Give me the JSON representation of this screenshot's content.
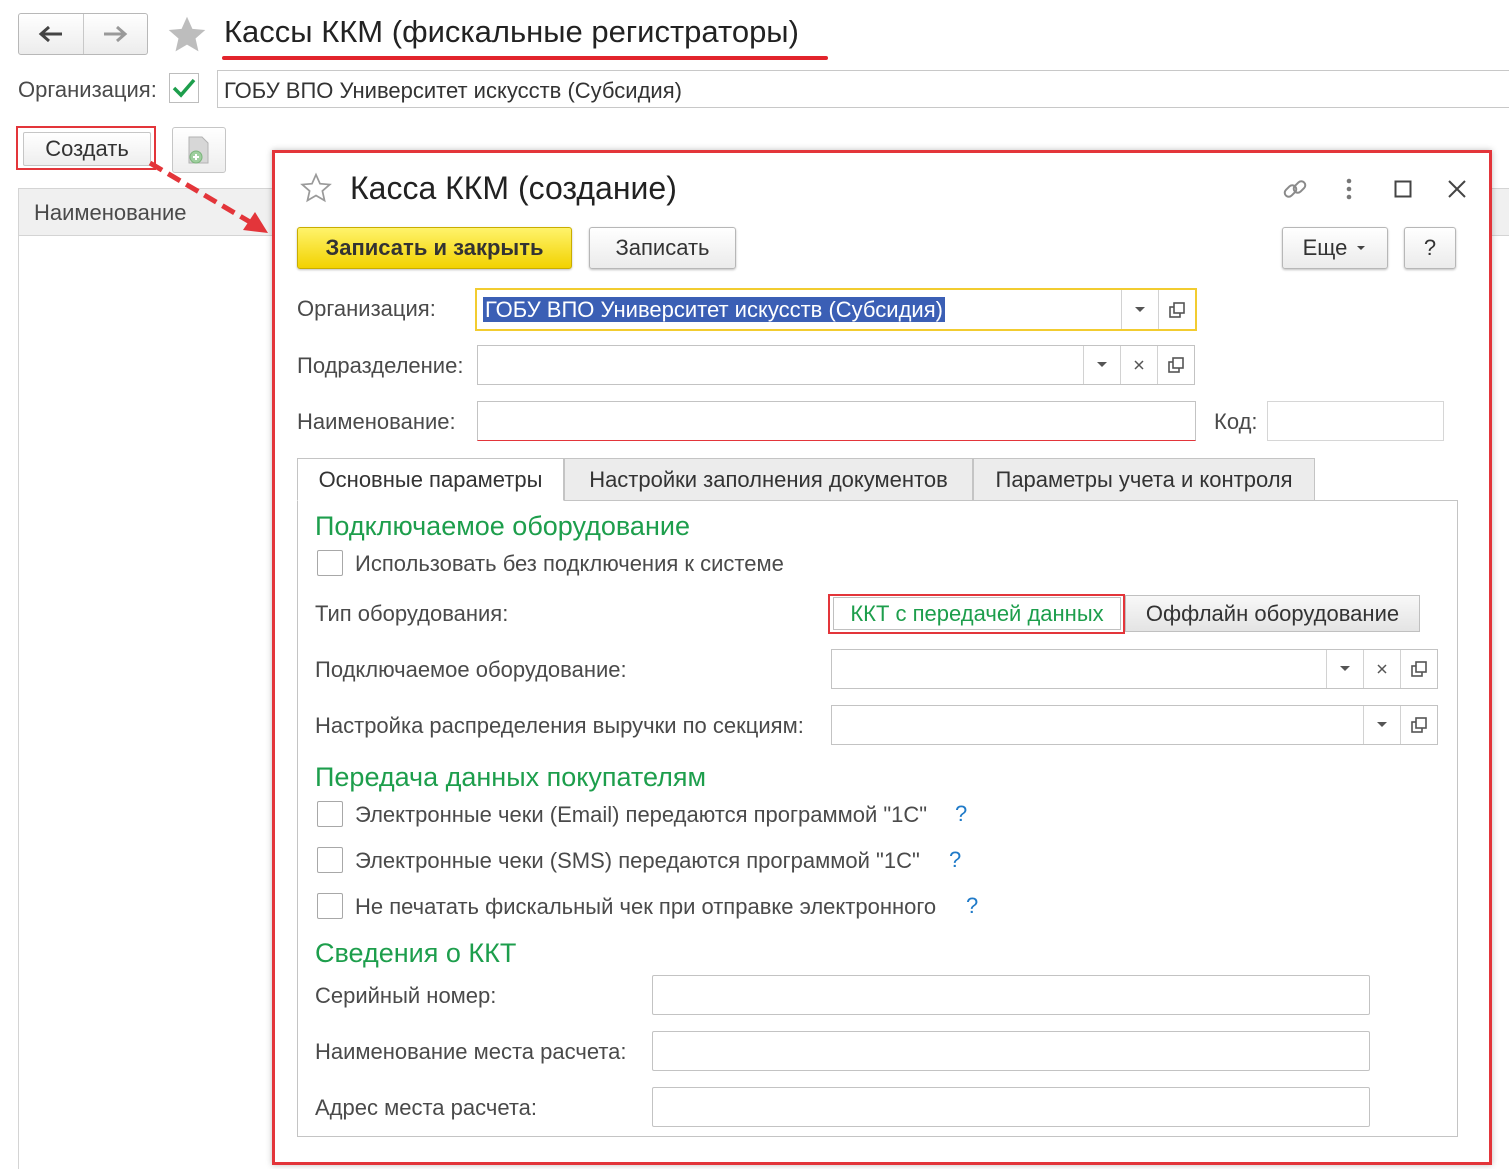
{
  "list_window": {
    "title": "Кассы ККМ (фискальные регистраторы)",
    "org_label": "Организация:",
    "org_checked": true,
    "org_value": "ГОБУ ВПО Университет искусств (Субсидия)",
    "create_button": "Создать",
    "column_name": "Наименование"
  },
  "dialog": {
    "title": "Касса ККМ (создание)",
    "buttons": {
      "save_close": "Записать и закрыть",
      "save": "Записать",
      "more": "Еще",
      "help": "?"
    },
    "fields": {
      "org_label": "Организация:",
      "org_value": "ГОБУ ВПО Университет искусств (Субсидия)",
      "subdivision_label": "Подразделение:",
      "subdivision_value": "",
      "name_label": "Наименование:",
      "name_value": "",
      "code_label": "Код:",
      "code_value": ""
    },
    "tabs": [
      "Основные параметры",
      "Настройки заполнения документов",
      "Параметры учета и контроля"
    ],
    "active_tab": "Основные параметры",
    "equipment": {
      "heading": "Подключаемое оборудование",
      "use_without_connection": "Использовать без подключения к системе",
      "type_label": "Тип оборудования:",
      "type_options": [
        "ККТ с передачей данных",
        "Оффлайн оборудование"
      ],
      "type_selected": "ККТ с передачей данных",
      "device_label": "Подключаемое оборудование:",
      "distribution_label": "Настройка распределения выручки по секциям:"
    },
    "customers": {
      "heading": "Передача данных покупателям",
      "email_checks": "Электронные чеки (Email) передаются программой \"1С\"",
      "sms_checks": "Электронные чеки (SMS) передаются программой \"1С\"",
      "no_print": "Не печатать фискальный чек при отправке электронного",
      "help_mark": "?"
    },
    "kkt": {
      "heading": "Сведения о ККТ",
      "serial_label": "Серийный номер:",
      "place_name_label": "Наименование места расчета:",
      "place_address_label": "Адрес места расчета:"
    }
  },
  "icons": [
    "arrow-left-icon",
    "arrow-right-icon",
    "star-icon",
    "checkmark-icon",
    "copy-document-icon",
    "link-icon",
    "more-vert-icon",
    "maximize-icon",
    "close-icon",
    "dropdown-icon",
    "clear-icon",
    "open-icon"
  ],
  "colors": {
    "accent_green": "#1d9e4c",
    "highlight_red": "#e3353a",
    "primary_yellow": "#f2d200",
    "help_blue": "#1f7ac8"
  }
}
